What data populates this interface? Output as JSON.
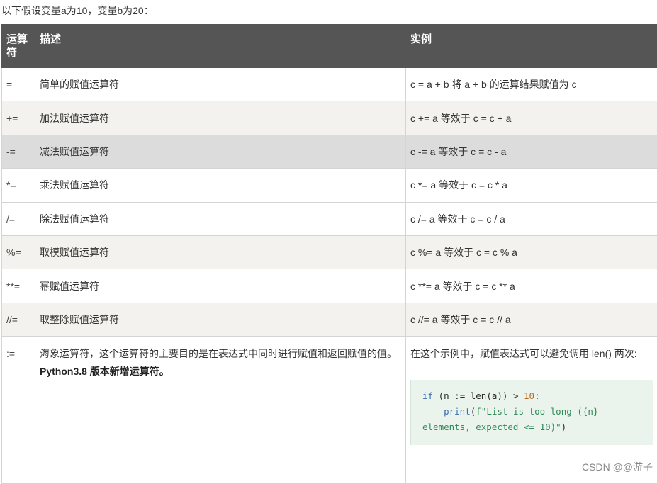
{
  "intro": "以下假设变量a为10，变量b为20：",
  "headers": {
    "operator": "运算符",
    "description": "描述",
    "example": "实例"
  },
  "rows": [
    {
      "op": "=",
      "desc": "简单的赋值运算符",
      "example": "c = a + b 将 a + b 的运算结果赋值为 c"
    },
    {
      "op": "+=",
      "desc": "加法赋值运算符",
      "example": "c += a 等效于 c = c + a"
    },
    {
      "op": "-=",
      "desc": "减法赋值运算符",
      "example": "c -= a 等效于 c = c - a"
    },
    {
      "op": "*=",
      "desc": "乘法赋值运算符",
      "example": "c *= a 等效于 c = c * a"
    },
    {
      "op": "/=",
      "desc": "除法赋值运算符",
      "example": "c /= a 等效于 c = c / a"
    },
    {
      "op": "%=",
      "desc": "取模赋值运算符",
      "example": "c %= a 等效于 c = c % a"
    },
    {
      "op": "**=",
      "desc": "幂赋值运算符",
      "example": "c **= a 等效于 c = c ** a"
    },
    {
      "op": "//=",
      "desc": "取整除赋值运算符",
      "example": "c //= a 等效于 c = c // a"
    }
  ],
  "walrus": {
    "op": ":=",
    "desc": "海象运算符，这个运算符的主要目的是在表达式中同时进行赋值和返回赋值的值。",
    "desc_bold": "Python3.8 版本新增运算符。",
    "example_text": "在这个示例中，赋值表达式可以避免调用 len() 两次:",
    "code": {
      "kw_if": "if",
      "part1": " (n := len(a)) > ",
      "num": "10",
      "part2": ":",
      "indent": "    ",
      "print": "print",
      "paren_open": "(",
      "fstring": "f\"List is too long ({n} elements, expected <= 10)\"",
      "paren_close": ")"
    }
  },
  "watermark": "CSDN @@游子",
  "colors": {
    "header_bg": "#555555",
    "row_alt_bg": "#f4f2ee",
    "row_highlight_bg": "#dcdcdc",
    "code_bg": "#eaf3ec"
  }
}
